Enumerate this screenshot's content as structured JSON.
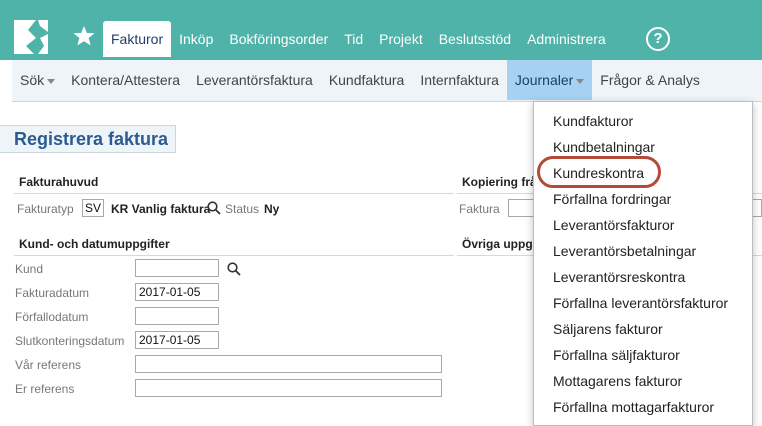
{
  "topnav": {
    "items": [
      "Fakturor",
      "Inköp",
      "Bokföringsorder",
      "Tid",
      "Projekt",
      "Beslutsstöd",
      "Administrera"
    ],
    "active_index": 0,
    "help_label": "?"
  },
  "subnav": {
    "items": [
      "Sök",
      "Kontera/Attestera",
      "Leverantörsfaktura",
      "Kundfaktura",
      "Internfaktura",
      "Journaler",
      "Frågor & Analys"
    ],
    "active_index": 5,
    "caret_items": [
      0,
      5
    ]
  },
  "page": {
    "title": "Registrera faktura"
  },
  "fakturahuvud": {
    "header": "Fakturahuvud",
    "fakturatyp_label": "Fakturatyp",
    "fakturatyp_code": "SV",
    "fakturatyp_name": "KR Vanlig faktura",
    "status_label": "Status",
    "status_value": "Ny"
  },
  "kopiering": {
    "header": "Kopiering frå",
    "faktura_label": "Faktura"
  },
  "kund": {
    "header": "Kund- och datumuppgifter",
    "kund_label": "Kund",
    "fakturadatum_label": "Fakturadatum",
    "fakturadatum_value": "2017-01-05",
    "forfallodatum_label": "Förfallodatum",
    "slutkontering_label": "Slutkonteringsdatum",
    "slutkontering_value": "2017-01-05",
    "var_referens_label": "Vår referens",
    "er_referens_label": "Er referens"
  },
  "ovriga": {
    "header": "Övriga uppgi"
  },
  "journaler_menu": {
    "items": [
      "Kundfakturor",
      "Kundbetalningar",
      "Kundreskontra",
      "Förfallna fordringar",
      "Leverantörsfakturor",
      "Leverantörsbetalningar",
      "Leverantörsreskontra",
      "Förfallna leverantörsfakturor",
      "Säljarens fakturor",
      "Förfallna säljfakturor",
      "Mottagarens fakturor",
      "Förfallna mottagarfakturor"
    ],
    "highlighted_index": 2
  },
  "colors": {
    "topbar": "#4fb3a9",
    "subnav_bg": "#eef4f7",
    "subnav_active": "#a6d1f2",
    "title_text": "#2a5b92",
    "highlight_ring": "#b54a38"
  },
  "icons": [
    "logo-icon",
    "star-icon",
    "help-icon",
    "search-icon",
    "caret-down-icon"
  ]
}
